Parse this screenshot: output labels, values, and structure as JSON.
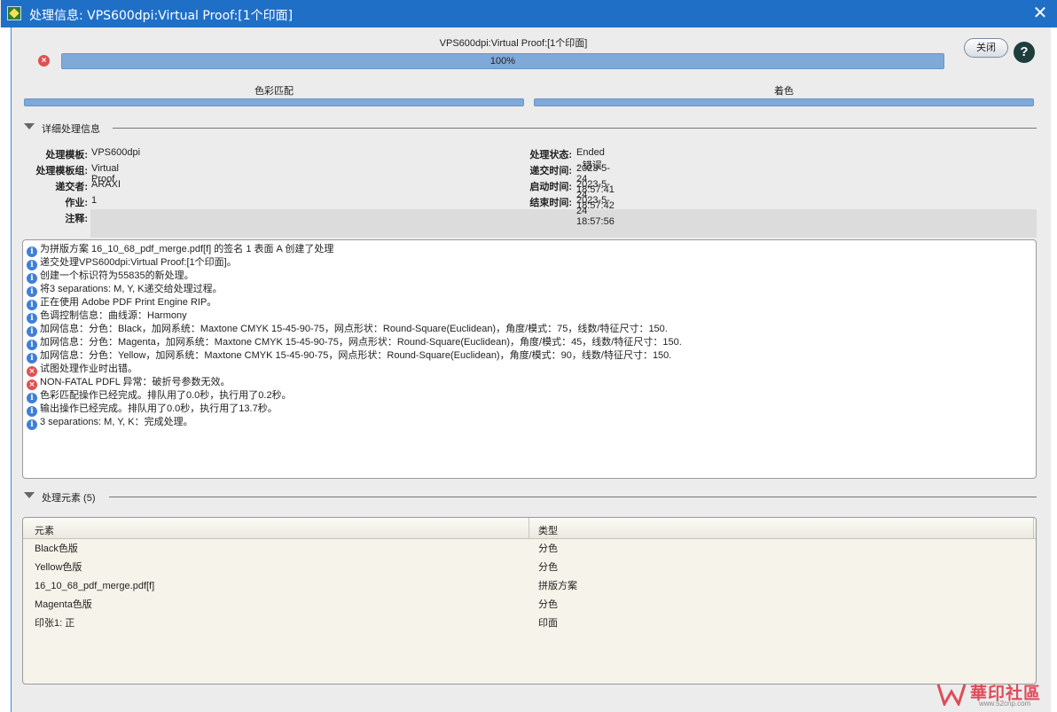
{
  "window": {
    "title": "处理信息: VPS600dpi:Virtual Proof:[1个印面]"
  },
  "header": {
    "job_caption": "VPS600dpi:Virtual Proof:[1个印面]",
    "progress_text": "100%",
    "progress_value": 1.0,
    "close_label": "关闭",
    "help_label": "?"
  },
  "stages": [
    {
      "label": "色彩匹配",
      "progress": 1.0
    },
    {
      "label": "着色",
      "progress": 1.0
    }
  ],
  "details": {
    "section_label": "详细处理信息",
    "left": [
      {
        "key": "处理模板:",
        "value": "VPS600dpi"
      },
      {
        "key": "处理模板组:",
        "value": "Virtual Proof"
      },
      {
        "key": "递交者:",
        "value": "ARAXI"
      },
      {
        "key": "作业:",
        "value": "1"
      },
      {
        "key": "注释:",
        "value": ""
      }
    ],
    "right": [
      {
        "key": "处理状态:",
        "value": "Ended - 错误"
      },
      {
        "key": "递交时间:",
        "value": "2023-5-24 18:57:41"
      },
      {
        "key": "启动时间:",
        "value": "2023-5-24 18:57:42"
      },
      {
        "key": "结束时间:",
        "value": "2023-5-24 18:57:56"
      }
    ]
  },
  "log": [
    {
      "type": "info",
      "text": "为拼版方案 16_10_68_pdf_merge.pdf[f] 的签名 1 表面 A 创建了处理"
    },
    {
      "type": "info",
      "text": "递交处理VPS600dpi:Virtual Proof:[1个印面]。"
    },
    {
      "type": "info",
      "text": "创建一个标识符为55835的新处理。"
    },
    {
      "type": "info",
      "text": "将3 separations: M, Y, K递交给处理过程。"
    },
    {
      "type": "info",
      "text": "正在使用 Adobe PDF Print Engine RIP。"
    },
    {
      "type": "info",
      "text": "色调控制信息：曲线源：Harmony"
    },
    {
      "type": "info",
      "text": "加网信息：分色：Black，加网系统：Maxtone CMYK 15-45-90-75，网点形状：Round-Square(Euclidean)，角度/模式：75，线数/特征尺寸：150."
    },
    {
      "type": "info",
      "text": "加网信息：分色：Magenta，加网系统：Maxtone CMYK 15-45-90-75，网点形状：Round-Square(Euclidean)，角度/模式：45，线数/特征尺寸：150."
    },
    {
      "type": "info",
      "text": "加网信息：分色：Yellow，加网系统：Maxtone CMYK 15-45-90-75，网点形状：Round-Square(Euclidean)，角度/模式：90，线数/特征尺寸：150."
    },
    {
      "type": "error",
      "text": "试图处理作业时出错。"
    },
    {
      "type": "error",
      "text": "NON-FATAL PDFL 异常：破折号参数无效。"
    },
    {
      "type": "info",
      "text": "色彩匹配操作已经完成。排队用了0.0秒，执行用了0.2秒。"
    },
    {
      "type": "info",
      "text": "输出操作已经完成。排队用了0.0秒，执行用了13.7秒。"
    },
    {
      "type": "info",
      "text": "3 separations: M, Y, K：完成处理。"
    }
  ],
  "elements": {
    "section_label": "处理元素 (5)",
    "columns": [
      "元素",
      "类型"
    ],
    "rows": [
      [
        "Black色版",
        "分色"
      ],
      [
        "Yellow色版",
        "分色"
      ],
      [
        "16_10_68_pdf_merge.pdf[f]",
        "拼版方案"
      ],
      [
        "Magenta色版",
        "分色"
      ],
      [
        "印张1: 正",
        "印面"
      ]
    ]
  },
  "watermark": {
    "text": "華印社區",
    "url": "www.52cnp.com"
  },
  "colors": {
    "titlebar": "#1f6fc7",
    "progress_fill": "#7fa9d8",
    "error": "#e05050",
    "info": "#3f7fd6"
  }
}
